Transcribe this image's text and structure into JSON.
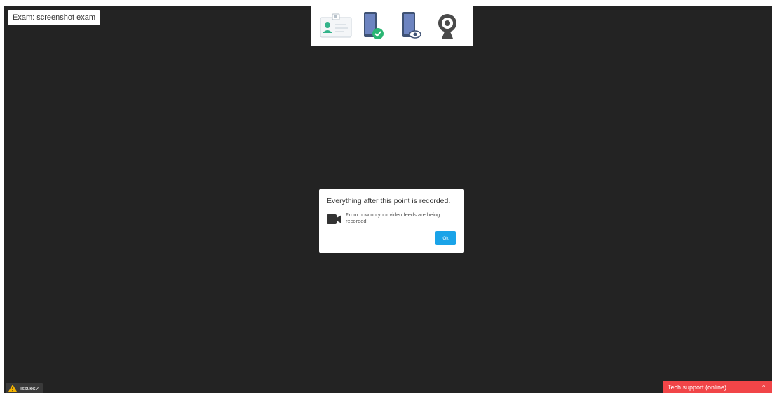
{
  "header": {
    "exam_label": "Exam: screenshot exam"
  },
  "status_icons": [
    {
      "name": "id-card-icon"
    },
    {
      "name": "phone-check-icon"
    },
    {
      "name": "phone-eye-icon"
    },
    {
      "name": "webcam-icon"
    }
  ],
  "modal": {
    "title": "Everything after this point is recorded.",
    "message": "From now on your video feeds are being recorded.",
    "ok_label": "Ok"
  },
  "footer": {
    "issues_label": "Issues?",
    "tech_support_label": "Tech support (online)",
    "tech_support_chevron": "^"
  },
  "colors": {
    "background": "#232323",
    "ok_button": "#1aa3e8",
    "tech_support": "#f14548",
    "warning": "#f5b400",
    "check": "#2bb673"
  }
}
